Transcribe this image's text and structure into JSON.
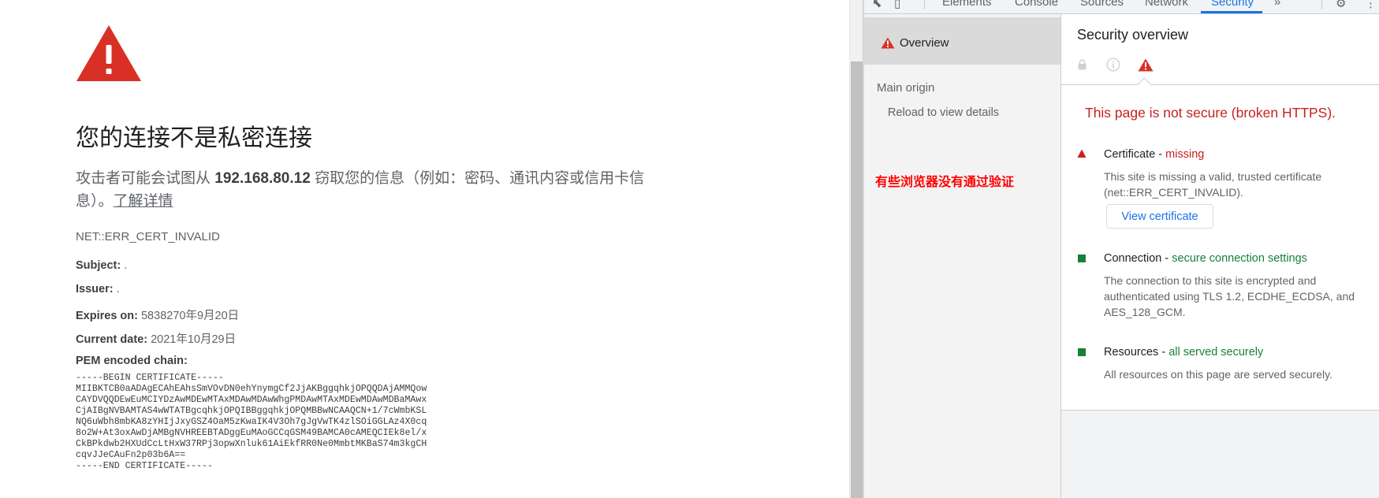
{
  "page": {
    "heading": "您的连接不是私密连接",
    "desc_prefix": "攻击者可能会试图从 ",
    "desc_host": "192.168.80.12",
    "desc_suffix": " 窃取您的信息（例如：密码、通讯内容或信用卡信息）。",
    "learn_more": "了解详情",
    "error_code": "NET::ERR_CERT_INVALID",
    "subject_label": "Subject:",
    "subject_value": " .",
    "issuer_label": "Issuer:",
    "issuer_value": " .",
    "expires_label": "Expires on:",
    "expires_value": " 5838270年9月20日",
    "current_label": "Current date:",
    "current_value": " 2021年10月29日",
    "pem_label": "PEM encoded chain:",
    "pem": "-----BEGIN CERTIFICATE-----\nMIIBKTCB0aADAgECAhEAhsSmVOvDN0ehYnymgCf2JjAKBggqhkjOPQQDAjAMMQow\nCAYDVQQDEwEuMCIYDzAwMDEwMTAxMDAwMDAwWhgPMDAwMTAxMDEwMDAwMDBaMAwx\nCjAIBgNVBAMTAS4wWTATBgcqhkjOPQIBBggqhkjOPQMBBwNCAAQCN+1/7cWmbKSL\nNQ6uWbh8mbKA8zYHIjJxyGSZ4OaM5zKwaIK4V3Oh7gJgVwTK4zlSOiGGLAz4X0cq\n8o2W+At3oxAwDjAMBgNVHREEBTADggEuMAoGCCqGSM49BAMCA0cAMEQCIEk8el/x\nCkBPkdwb2HXUdCcLtHxW37RPj3opwXnluk61AiEkfRR0Ne0MmbtMKBaS74m3kgCH\ncqvJJeCAuFn2p03b6A==\n-----END CERTIFICATE-----"
  },
  "devtools": {
    "tabs": [
      "Elements",
      "Console",
      "Sources",
      "Network",
      "Security"
    ],
    "active_tab": "Security",
    "more_tabs": "»",
    "sidebar": {
      "overview": "Overview",
      "main_origin": "Main origin",
      "reload": "Reload to view details",
      "annotation": "有些浏览器没有通过验证"
    },
    "overview": {
      "title": "Security overview",
      "summary": "This page is not secure (broken HTTPS).",
      "certificate": {
        "label": "Certificate - ",
        "status": "missing",
        "desc": "This site is missing a valid, trusted certificate (net::ERR_CERT_INVALID).",
        "button": "View certificate"
      },
      "connection": {
        "label": "Connection - ",
        "status": "secure connection settings",
        "desc": "The connection to this site is encrypted and authenticated using TLS 1.2, ECDHE_ECDSA, and AES_128_GCM."
      },
      "resources": {
        "label": "Resources - ",
        "status": "all served securely",
        "desc": "All resources on this page are served securely."
      }
    },
    "colors": {
      "danger": "#c5221f",
      "secure": "#188038",
      "accent": "#1a73e8",
      "warning_icon": "#d93025"
    }
  }
}
